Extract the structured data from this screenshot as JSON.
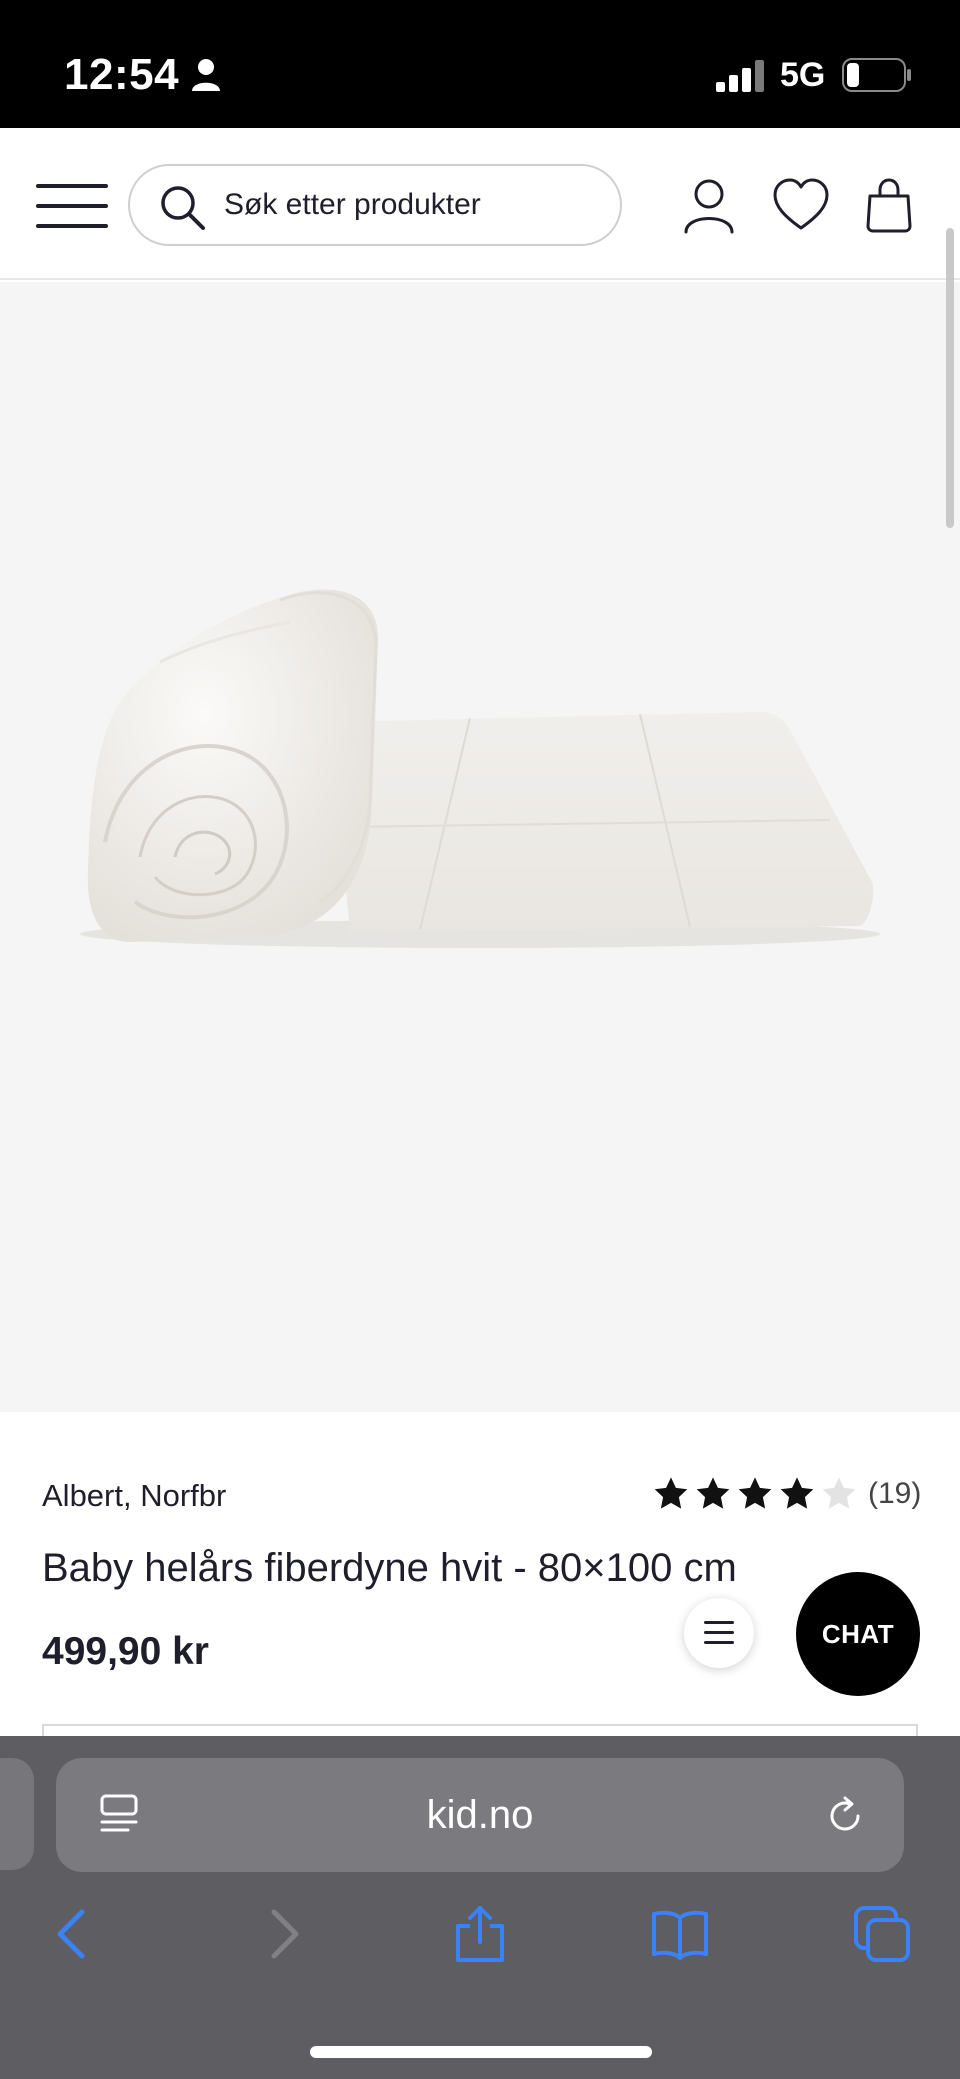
{
  "status_bar": {
    "time": "12:54",
    "network": "5G"
  },
  "header": {
    "search_placeholder": "Søk etter produkter"
  },
  "product": {
    "brand": "Albert, Norfbr",
    "title": "Baby helårs fiberdyne hvit - 80×100 cm",
    "price": "499,90 kr",
    "rating": {
      "stars": 4,
      "max": 5,
      "count": "(19)"
    }
  },
  "chat": {
    "label": "CHAT"
  },
  "browser": {
    "url": "kid.no"
  },
  "colors": {
    "accent_blue": "#3b82f6",
    "text": "#1f1f2b",
    "image_bg": "#f5f5f5"
  }
}
